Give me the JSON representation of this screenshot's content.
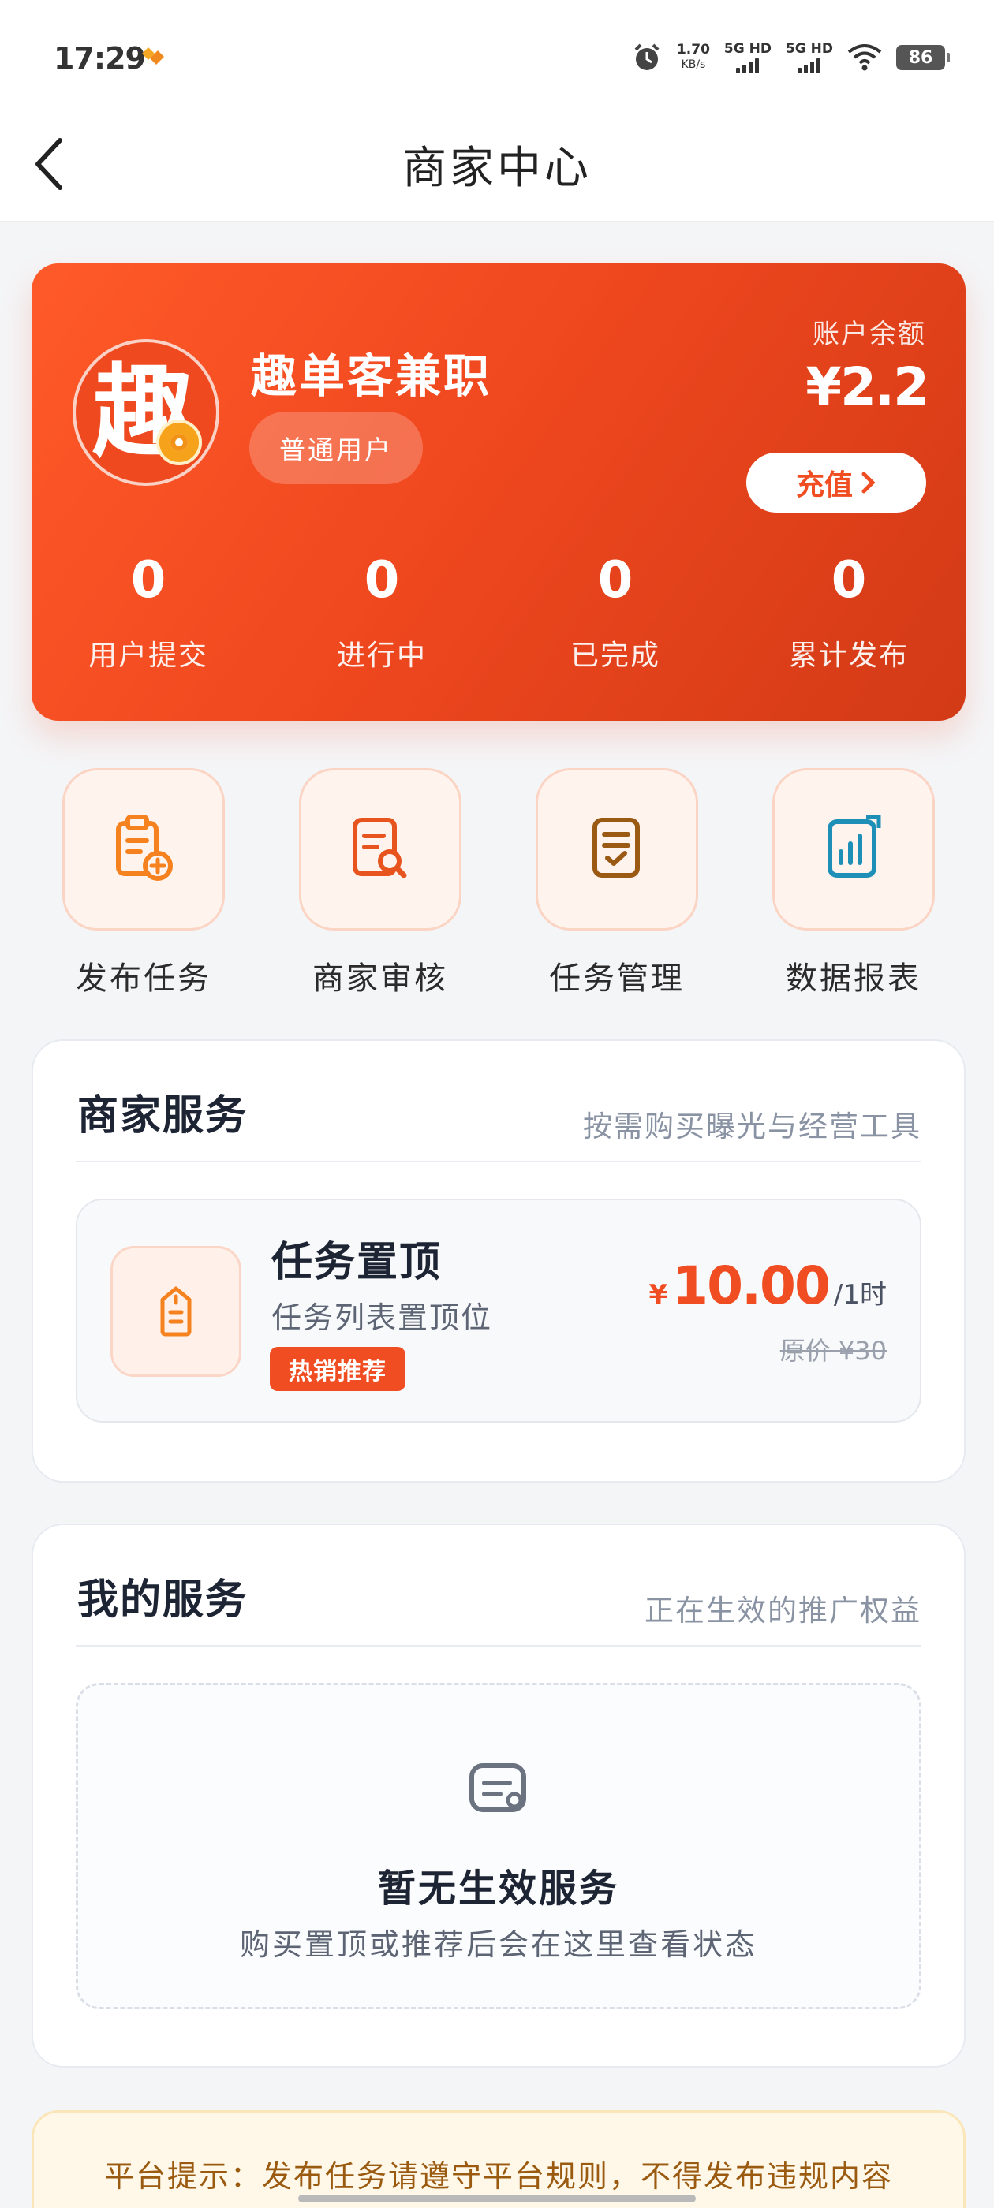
{
  "status_bar": {
    "time": "17:29",
    "net_speed_value": "1.70",
    "net_speed_unit": "KB/s",
    "sim1": "5G HD",
    "sim2": "5G HD",
    "battery": "86"
  },
  "nav": {
    "title": "商家中心",
    "back_icon": "chevron-left-icon"
  },
  "account": {
    "logo_char": "趣",
    "name": "趣单客兼职",
    "level": "普通用户",
    "balance_label": "账户余额",
    "balance_value": "¥2.2",
    "recharge_label": "充值",
    "stats": [
      {
        "value": "0",
        "label": "用户提交"
      },
      {
        "value": "0",
        "label": "进行中"
      },
      {
        "value": "0",
        "label": "已完成"
      },
      {
        "value": "0",
        "label": "累计发布"
      }
    ],
    "colors": {
      "gradient_start": "#ff5a29",
      "gradient_end": "#d23a16"
    }
  },
  "quick_actions": [
    {
      "label": "发布任务",
      "icon": "clipboard-add-icon",
      "color": "#f5821f"
    },
    {
      "label": "商家审核",
      "icon": "document-search-icon",
      "color": "#e8541e"
    },
    {
      "label": "任务管理",
      "icon": "document-check-icon",
      "color": "#9a5a14"
    },
    {
      "label": "数据报表",
      "icon": "bar-chart-icon",
      "color": "#1e90b8"
    }
  ],
  "merchant_services": {
    "title": "商家服务",
    "subtitle": "按需购买曝光与经营工具",
    "items": [
      {
        "name": "任务置顶",
        "desc": "任务列表置顶位",
        "tag": "热销推荐",
        "currency": "¥",
        "price": "10.00",
        "unit": "/1时",
        "original_price": "原价 ¥30",
        "icon": "pin-top-icon"
      }
    ]
  },
  "my_services": {
    "title": "我的服务",
    "subtitle": "正在生效的推广权益",
    "empty_title": "暂无生效服务",
    "empty_desc": "购买置顶或推荐后会在这里查看状态",
    "empty_icon": "message-card-icon"
  },
  "notice": {
    "text": "平台提示：发布任务请遵守平台规则，不得发布违规内容"
  }
}
